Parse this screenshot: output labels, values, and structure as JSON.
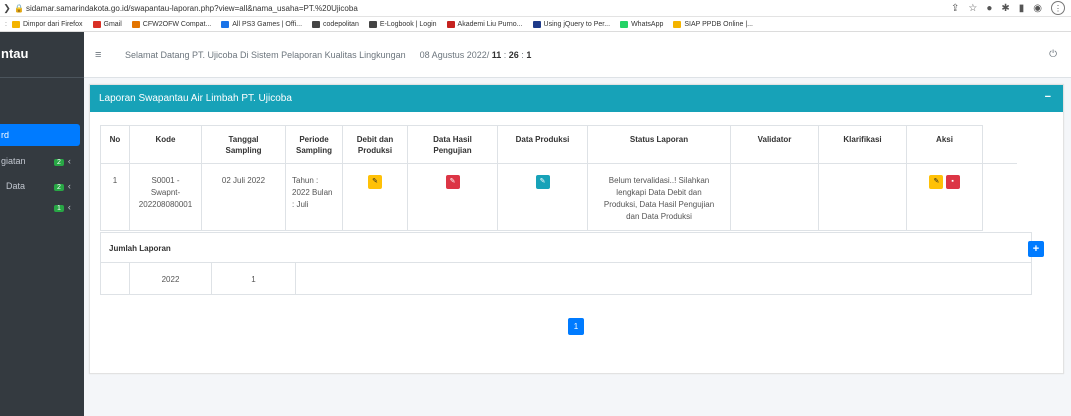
{
  "browser": {
    "url": "sidamar.samarindakota.go.id/swapantau-laporan.php?view=all&nama_usaha=PT.%20Ujicoba",
    "bookmarks": [
      {
        "label": "Dimpor dari Firefox",
        "color": "#f4b400"
      },
      {
        "label": "Gmail",
        "color": "#d93025"
      },
      {
        "label": "CFW2OFW Compat...",
        "color": "#e37400"
      },
      {
        "label": "All PS3 Games | Offi...",
        "color": "#1a73e8"
      },
      {
        "label": "codepolitan",
        "color": "#444444"
      },
      {
        "label": "E-Logbook | Login",
        "color": "#444444"
      },
      {
        "label": "Akademi Liu Purno...",
        "color": "#c5221f"
      },
      {
        "label": "Using jQuery to Per...",
        "color": "#1e3a8a"
      },
      {
        "label": "WhatsApp",
        "color": "#25d366"
      },
      {
        "label": "SIAP PPDB Online |...",
        "color": "#f4b400"
      }
    ]
  },
  "sidebar": {
    "brand": "ntau",
    "items": [
      {
        "label": "rd",
        "badge": ""
      },
      {
        "label": "giatan",
        "badge": "2"
      },
      {
        "label": "Data",
        "badge": "2"
      },
      {
        "label": "",
        "badge": "1"
      }
    ]
  },
  "navbar": {
    "welcome": "Selamat Datang PT. Ujicoba Di Sistem Pelaporan Kualitas Lingkungan",
    "date": "08 Agustus 2022/",
    "hour": "11",
    "minute": "26",
    "second": "1"
  },
  "card": {
    "title": "Laporan Swapantau Air Limbah PT. Ujicoba",
    "minimize": "−"
  },
  "table": {
    "headers": {
      "no": "No",
      "kode": "Kode",
      "tanggal": "Tanggal Sampling",
      "periode": "Periode Sampling",
      "debit": "Debit dan Produksi",
      "hasil": "Data Hasil Pengujian",
      "produksi": "Data Produksi",
      "status": "Status Laporan",
      "validator": "Validator",
      "klarifikasi": "Klarifikasi",
      "aksi": "Aksi"
    },
    "row": {
      "no": "1",
      "kode": "S0001 - Swapnt- 202208080001",
      "tanggal": "02 Juli 2022",
      "periode": "Tahun : 2022 Bulan : Juli",
      "status": "Belum tervalidasi..! Silahkan lengkapi Data Debit dan Produksi, Data Hasil Pengujian dan Data Produksi",
      "validator": "",
      "klarifikasi": ""
    }
  },
  "summary": {
    "title": "Jumlah Laporan",
    "year": "2022",
    "count": "1"
  },
  "pagination": {
    "current": "1"
  },
  "colors": {
    "header": "#17a2b8",
    "primary": "#007bff",
    "warning": "#ffc107",
    "danger": "#dc3545",
    "sidebar": "#343a40"
  }
}
